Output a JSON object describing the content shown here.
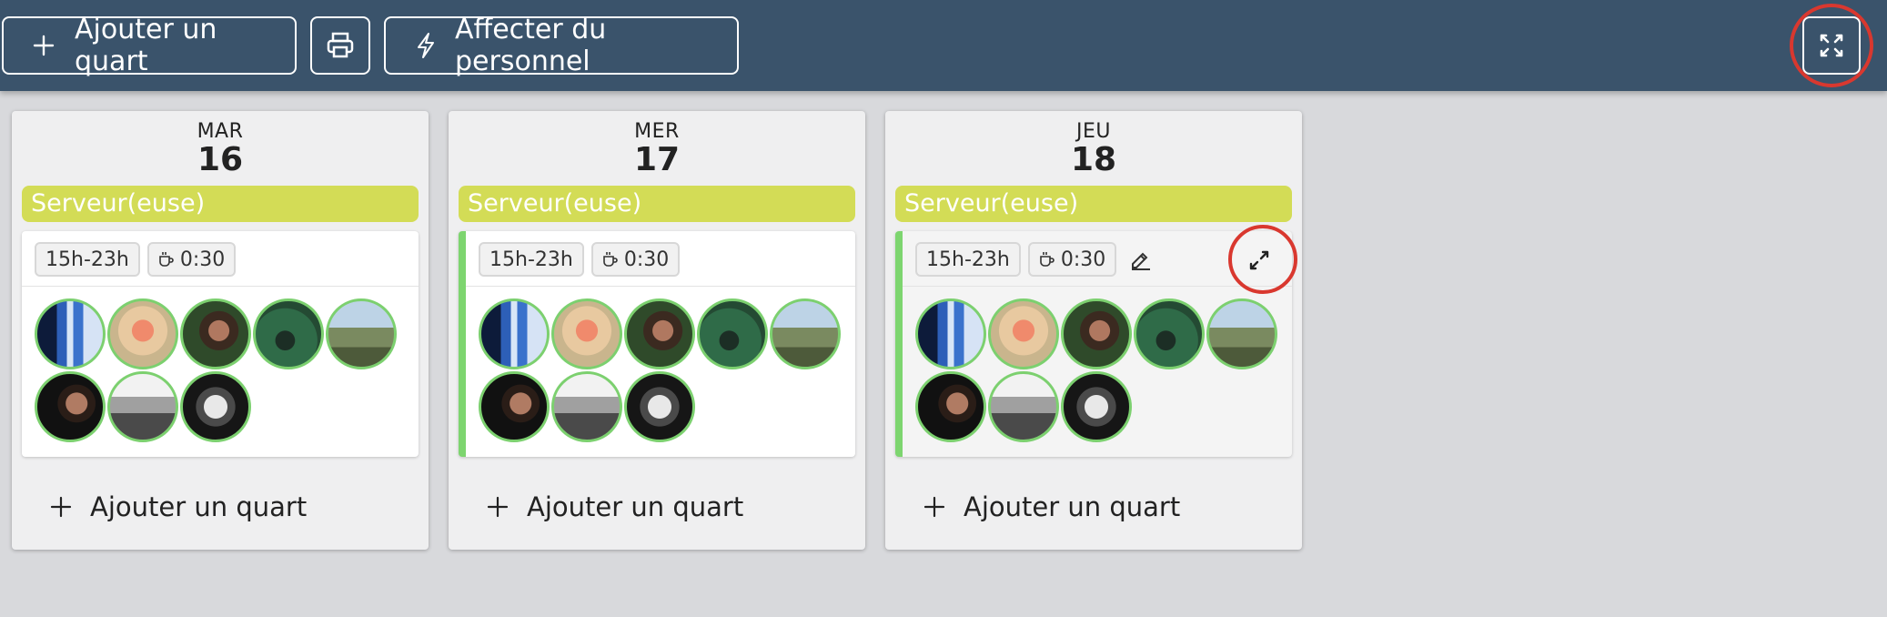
{
  "toolbar": {
    "add_shift_label": "Ajouter un quart",
    "print_icon": "printer-icon",
    "assign_label": "Affecter du personnel",
    "assign_icon": "lightning-icon",
    "fullscreen_icon": "fullscreen-icon"
  },
  "columns": [
    {
      "day_name": "MAR",
      "day_number": "16",
      "role": "Serveur(euse)",
      "shift": {
        "time": "15h-23h",
        "break": "0:30",
        "avatar_count": 8
      },
      "add_label": "Ajouter un quart"
    },
    {
      "day_name": "MER",
      "day_number": "17",
      "role": "Serveur(euse)",
      "shift": {
        "time": "15h-23h",
        "break": "0:30",
        "avatar_count": 8
      },
      "add_label": "Ajouter un quart"
    },
    {
      "day_name": "JEU",
      "day_number": "18",
      "role": "Serveur(euse)",
      "shift": {
        "time": "15h-23h",
        "break": "0:30",
        "avatar_count": 8,
        "edit_icon": "pencil-icon",
        "expand_icon": "expand-icon"
      },
      "add_label": "Ajouter un quart"
    }
  ],
  "colors": {
    "topbar": "#3a536b",
    "role_band": "#d3dc56",
    "avatar_ring": "#7cd06f",
    "shift_accent": "#7dd56f",
    "highlight_ring": "#d9382f"
  }
}
